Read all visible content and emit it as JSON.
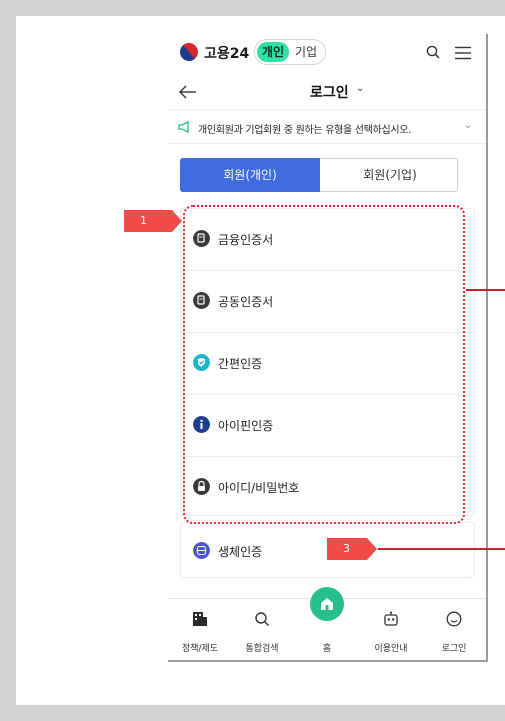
{
  "header": {
    "brand": "고용24",
    "mode_active": "개인",
    "mode_inactive": "기업"
  },
  "subheader": {
    "title": "로그인"
  },
  "notice": {
    "text": "개인회원과 기업회원 중 원하는 유형을 선택하십시오."
  },
  "tabs": [
    {
      "label": "회원(개인)"
    },
    {
      "label": "회원(기업)"
    }
  ],
  "login_methods": [
    {
      "label": "금융인증서",
      "icon": "certificate-icon"
    },
    {
      "label": "공동인증서",
      "icon": "certificate-icon"
    },
    {
      "label": "간편인증",
      "icon": "shield-check-icon"
    },
    {
      "label": "아이핀인증",
      "icon": "info-icon"
    },
    {
      "label": "아이디/비밀번호",
      "icon": "lock-icon"
    }
  ],
  "biometric": {
    "label": "생체인증",
    "icon": "biometric-icon"
  },
  "bottom_nav": [
    {
      "label": "정책/제도"
    },
    {
      "label": "통합검색"
    },
    {
      "label": "홈"
    },
    {
      "label": "이용안내"
    },
    {
      "label": "로그인"
    }
  ],
  "annotations": [
    {
      "label": "1"
    },
    {
      "label": "3"
    }
  ],
  "colors": {
    "accent": "#3f6be0",
    "brand_green": "#32e0a4",
    "annotation_red": "#f04a4a"
  }
}
